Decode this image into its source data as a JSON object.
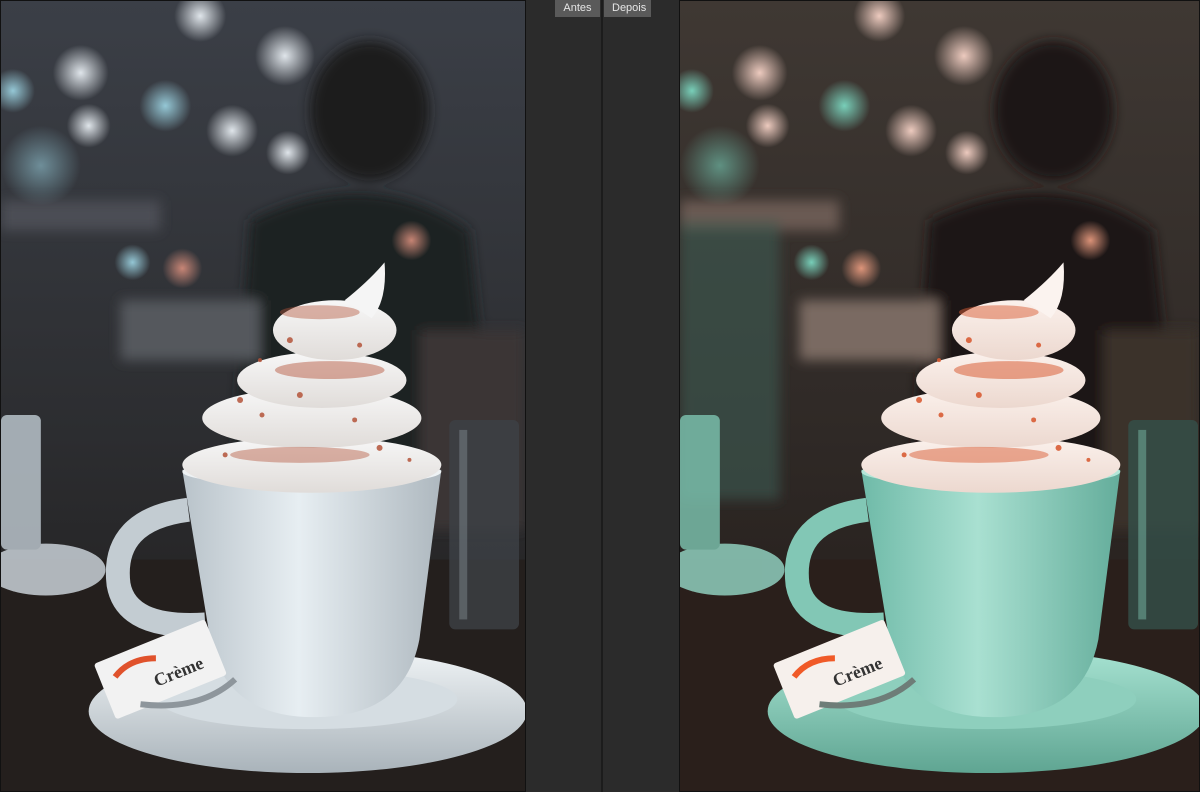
{
  "compare_view": {
    "before_label": "Antes",
    "after_label": "Depois"
  },
  "sugar_packet": {
    "brand_text": "Crème"
  },
  "colors": {
    "before_cup": "#dfe6ea",
    "after_cup": "#9fd8c8",
    "before_background": "#3a3d42",
    "after_background": "#3d3430",
    "topping": "#c2573a",
    "packet_logo": "#e0522c"
  }
}
